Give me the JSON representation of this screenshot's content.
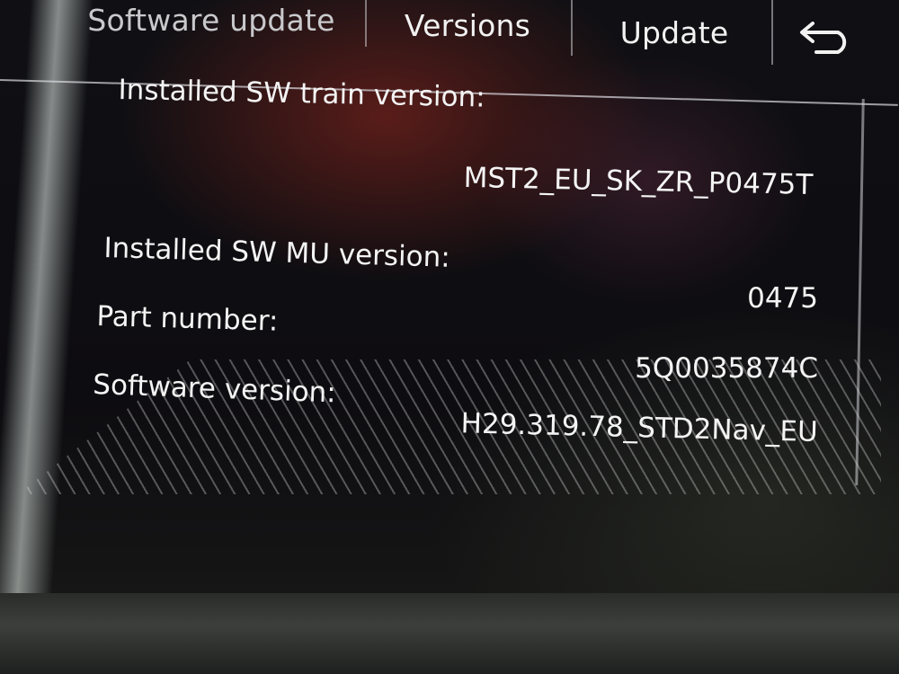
{
  "header": {
    "title": "Software update",
    "tabs": [
      {
        "label": "Versions"
      },
      {
        "label": "Update"
      }
    ],
    "back_icon": "back-arrow-icon"
  },
  "main": {
    "rows": [
      {
        "label": "Installed SW train version:",
        "value": "MST2_EU_SK_ZR_P0475T"
      },
      {
        "label": "Installed SW MU version:",
        "value": "0475"
      },
      {
        "label": "Part number:",
        "value": "5Q0035874C"
      },
      {
        "label": "Software version:",
        "value": "H29.319.78_STD2Nav_EU"
      }
    ]
  },
  "colors": {
    "text": "#f4f4f4",
    "title_text": "#c9c9cc",
    "background": "#0d0c10",
    "divider": "#dcdce1"
  }
}
